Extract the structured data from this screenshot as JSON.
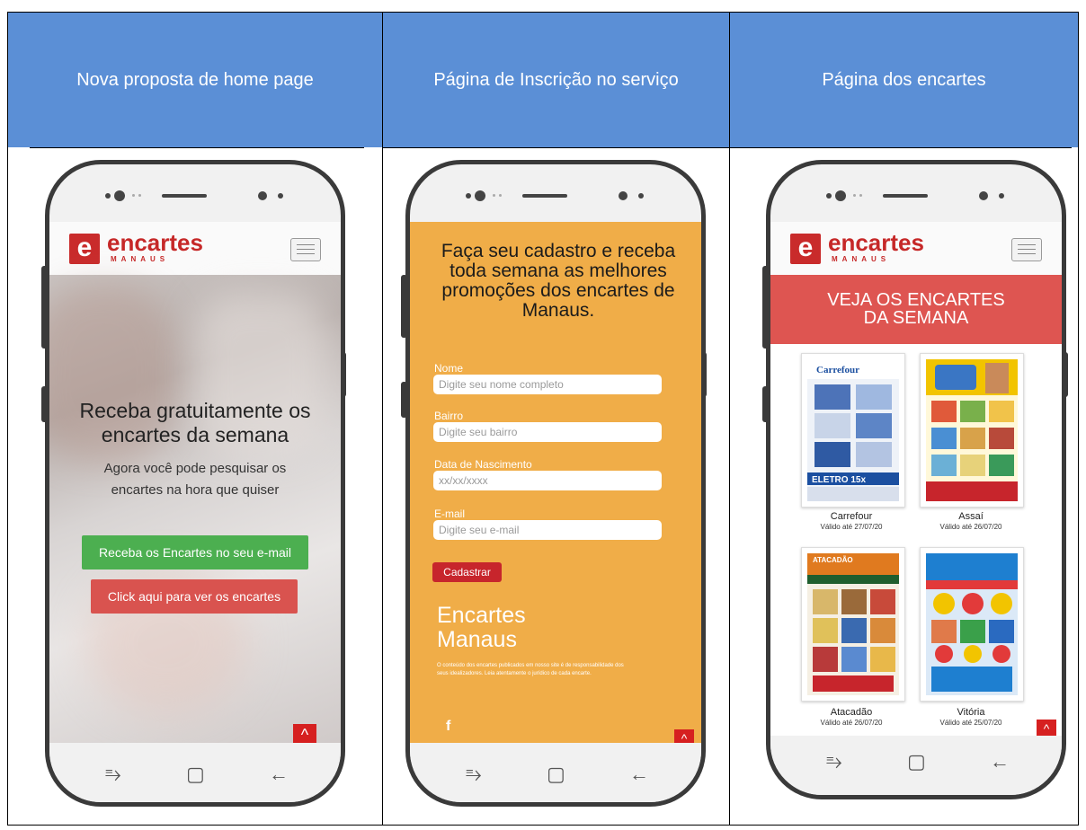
{
  "columns": [
    {
      "header": "Nova proposta de home page"
    },
    {
      "header": "Página de Inscrição no serviço"
    },
    {
      "header": "Página dos encartes"
    }
  ],
  "logo": {
    "letter": "e",
    "name": "encartes",
    "sub": "MANAUS"
  },
  "home": {
    "title": "Receba gratuitamente os encartes da semana",
    "subtitle": "Agora você pode pesquisar os encartes na hora que quiser",
    "btn_email": "Receba os Encartes no seu e-mail",
    "btn_view": "Click aqui para ver os encartes"
  },
  "signup": {
    "title": "Faça seu cadastro e receba toda semana as melhores promoções dos encartes de Manaus.",
    "fields": [
      {
        "label": "Nome",
        "placeholder": "Digite seu nome completo"
      },
      {
        "label": "Bairro",
        "placeholder": "Digite seu bairro"
      },
      {
        "label": "Data de Nascimento",
        "placeholder": "xx/xx/xxxx"
      },
      {
        "label": "E-mail",
        "placeholder": "Digite seu e-mail"
      }
    ],
    "submit": "Cadastrar",
    "brand_line1": "Encartes",
    "brand_line2": "Manaus",
    "disclaimer": "O conteúdo dos encartes publicados em nosso site é de responsabilidade dos seus idealizadores. Leia atentamente o jurídico de cada encarte.",
    "facebook": "f"
  },
  "flyers": {
    "banner_line1": "VEJA OS ENCARTES",
    "banner_line2": "DA SEMANA",
    "items": [
      {
        "name": "Carrefour",
        "valid": "Válido até 27/07/20",
        "color": "#1b4fa0"
      },
      {
        "name": "Assaí",
        "valid": "Válido até 26/07/20",
        "color": "#f2c400"
      },
      {
        "name": "Atacadão",
        "valid": "Válido até 26/07/20",
        "color": "#e07a1f"
      },
      {
        "name": "Vitória",
        "valid": "Válido até 25/07/20",
        "color": "#1e7fd0"
      }
    ]
  },
  "icons": {
    "back_to_top": "^",
    "nav_recent": "⥱",
    "nav_home": "▢",
    "nav_back": "←"
  }
}
